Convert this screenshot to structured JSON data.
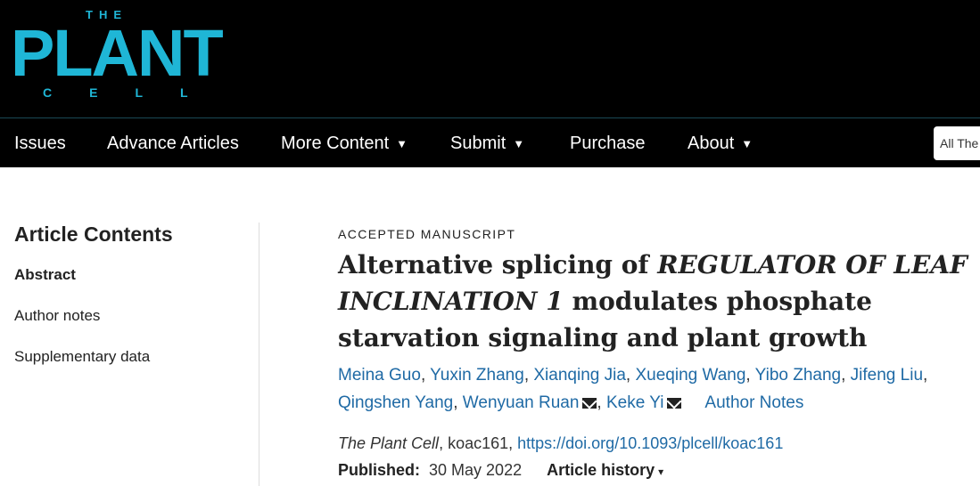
{
  "logo": {
    "the": "THE",
    "plant": "PLANT",
    "cell": "CELL"
  },
  "nav": {
    "issues": "Issues",
    "advance": "Advance Articles",
    "more": "More Content",
    "submit": "Submit",
    "purchase": "Purchase",
    "about": "About",
    "caret": "▼",
    "search_scope": "All The"
  },
  "sidebar": {
    "title": "Article Contents",
    "items": [
      "Abstract",
      "Author notes",
      "Supplementary data"
    ]
  },
  "article": {
    "type": "ACCEPTED MANUSCRIPT",
    "title_pre": "Alternative splicing of ",
    "title_italic": "REGULATOR OF LEAF INCLINATION 1",
    "title_post": " modulates phosphate starvation signaling and plant growth",
    "authors": [
      "Meina Guo",
      "Yuxin Zhang",
      "Xianqing Jia",
      "Xueqing Wang",
      "Yibo Zhang",
      "Jifeng Liu",
      "Qingshen Yang",
      "Wenyuan Ruan",
      "Keke Yi"
    ],
    "author_notes": "Author Notes",
    "journal": "The Plant Cell",
    "citation_id": ", koac161, ",
    "doi": "https://doi.org/10.1093/plcell/koac161",
    "published_label": "Published:",
    "published_date": "30 May 2022",
    "history_label": "Article history",
    "history_caret": "▾"
  },
  "colors": {
    "brand": "#1fb6d6",
    "link": "#1f6aa5",
    "header_bg": "#000000"
  }
}
